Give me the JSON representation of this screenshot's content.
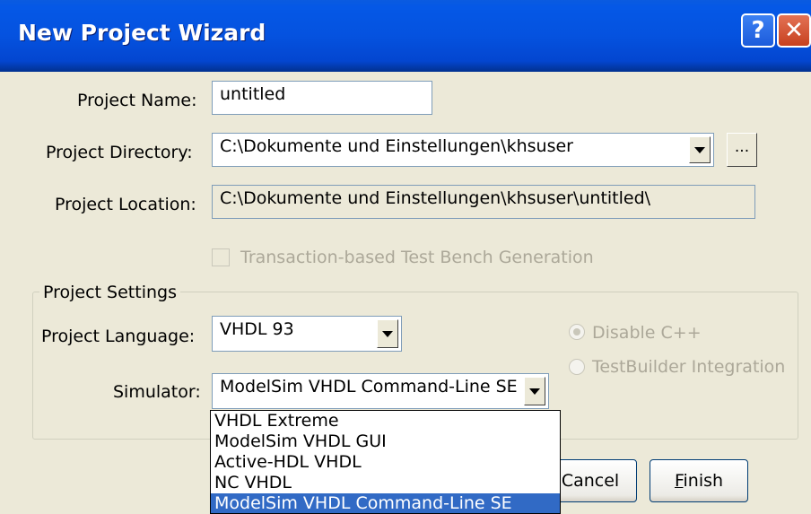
{
  "window": {
    "title": "New Project Wizard",
    "help_glyph": "?",
    "close_glyph": "✕"
  },
  "fields": {
    "project_name_label": "Project Name:",
    "project_name_value": "untitled",
    "project_directory_label": "Project Directory:",
    "project_directory_value": "C:\\Dokumente und Einstellungen\\khsuser",
    "browse_label": "...",
    "project_location_label": "Project Location:",
    "project_location_value": "C:\\Dokumente und Einstellungen\\khsuser\\untitled\\",
    "testbench_label": "Transaction-based Test Bench Generation"
  },
  "settings": {
    "group_label": "Project Settings",
    "language_label": "Project Language:",
    "language_value": "VHDL 93",
    "simulator_label": "Simulator:",
    "simulator_value": "ModelSim VHDL Command-Line SE",
    "disable_cpp_label": "Disable C++",
    "testbuilder_label": "TestBuilder Integration"
  },
  "simulator_options": [
    "VHDL Extreme",
    "ModelSim VHDL GUI",
    "Active-HDL VHDL",
    "NC VHDL",
    "ModelSim VHDL Command-Line SE"
  ],
  "buttons": {
    "cancel": "Cancel",
    "finish": "Finish"
  },
  "colors": {
    "titlebar": "#0552DF",
    "dialog_bg": "#ECE9D8",
    "selection": "#316AC5"
  }
}
